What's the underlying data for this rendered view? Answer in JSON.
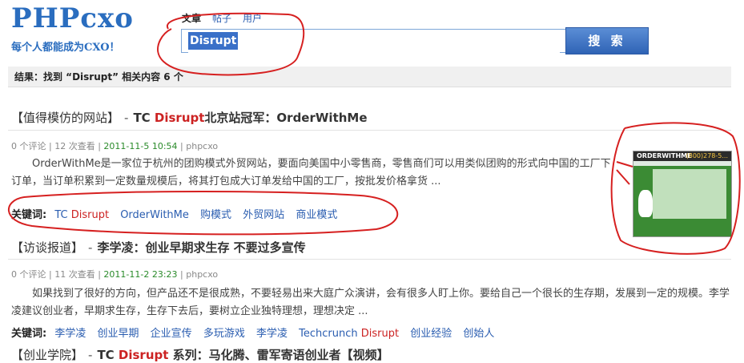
{
  "logo": {
    "name": "PHPcxo",
    "slogan": "每个人都能成为CXO！"
  },
  "search": {
    "tabs": [
      "文章",
      "帖子",
      "用户"
    ],
    "active_tab": 0,
    "query": "Disrupt",
    "button_label": "搜 索"
  },
  "result_summary": "结果：找到 “Disrupt” 相关内容 6 个",
  "results": [
    {
      "section": "【值得模仿的网站】",
      "dash": "-",
      "title_pre": "TC ",
      "title_hl": "Disrupt",
      "title_post": "北京站冠军：OrderWithMe",
      "comments": "0 个评论",
      "views": "12 次查看",
      "date": "2011-11-5 10:54",
      "author": "phpcxo",
      "summary": "OrderWithMe是一家位于杭州的团购模式外贸网站，要面向美国中小零售商，零售商们可以用类似团购的形式向中国的工厂下订单，当订单积累到一定数量规模后，将其打包成大订单发给中国的工厂，按批发价格拿货 ...",
      "keywords_label": "关键词:",
      "keywords": [
        "TC ",
        "Disrupt",
        "OrderWithMe",
        "购模式",
        "外贸网站",
        "商业模式"
      ],
      "thumbnail": {
        "header": "ORDERWITHME",
        "phone": "(800)278-5..."
      }
    },
    {
      "section": "【访谈报道】",
      "dash": "-",
      "title_pre": "李学凌：创业早期求生存 不要过多宣传",
      "comments": "0 个评论",
      "views": "11 次查看",
      "date": "2011-11-2 23:23",
      "author": "phpcxo",
      "summary": "如果找到了很好的方向，但产品还不是很成熟，不要轻易出来大庭广众演讲，会有很多人盯上你。要给自己一个很长的生存期，发展到一定的规模。李学凌建议创业者，早期求生存，生存下去后，要树立企业独特理想，理想决定 ...",
      "keywords_label": "关键词:",
      "keywords": [
        "李学凌",
        "创业早期",
        "企业宣传",
        "多玩游戏",
        "李学凌",
        "Techcrunch ",
        "Disrupt",
        "创业经验",
        "创始人"
      ]
    },
    {
      "section": "【创业学院】",
      "dash": "-",
      "title_pre": "TC ",
      "title_hl": "Disrupt",
      "title_post": " 系列：马化腾、雷军寄语创业者【视频】"
    }
  ],
  "annotation_color": "#d62020"
}
